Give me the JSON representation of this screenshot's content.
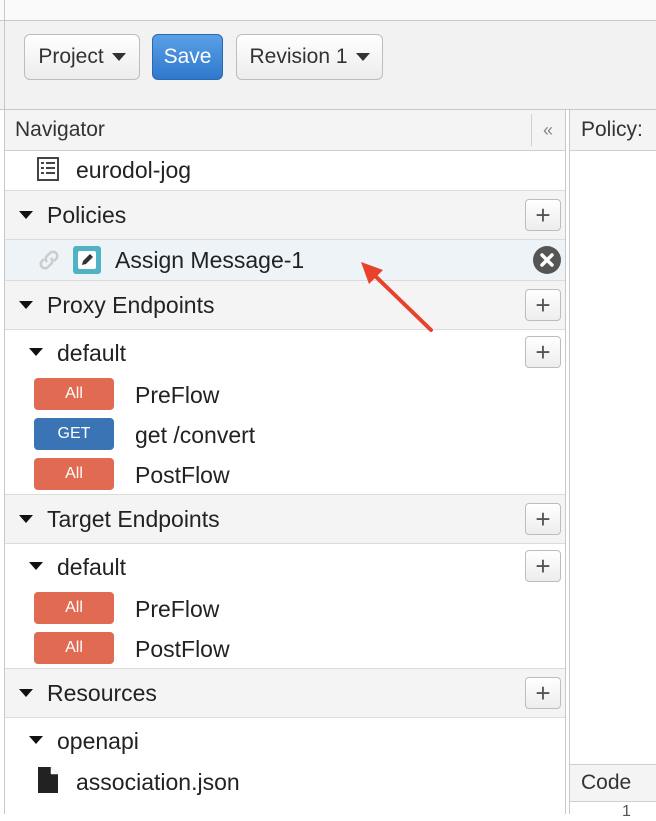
{
  "toolbar": {
    "project_label": "Project",
    "save_label": "Save",
    "revision_label": "Revision 1"
  },
  "navigator": {
    "title": "Navigator",
    "collapse_glyph": "«",
    "proxy_name": "eurodol-jog",
    "policies": {
      "label": "Policies",
      "items": [
        {
          "label": "Assign Message-1",
          "icon": "edit-policy-icon"
        }
      ]
    },
    "proxy_endpoints": {
      "label": "Proxy Endpoints",
      "default_label": "default",
      "flows": [
        {
          "badge": "All",
          "label": "PreFlow",
          "color": "#e06a52"
        },
        {
          "badge": "GET",
          "label": "get /convert",
          "color": "#3a74b5"
        },
        {
          "badge": "All",
          "label": "PostFlow",
          "color": "#e06a52"
        }
      ]
    },
    "target_endpoints": {
      "label": "Target Endpoints",
      "default_label": "default",
      "flows": [
        {
          "badge": "All",
          "label": "PreFlow",
          "color": "#e06a52"
        },
        {
          "badge": "All",
          "label": "PostFlow",
          "color": "#e06a52"
        }
      ]
    },
    "resources": {
      "label": "Resources",
      "folder_label": "openapi",
      "files": [
        "association.json"
      ]
    }
  },
  "policy_panel": {
    "title": "Policy: ",
    "code_label": "Code",
    "line_number": "1"
  },
  "annotation": {
    "arrow_color": "#e8412c"
  }
}
